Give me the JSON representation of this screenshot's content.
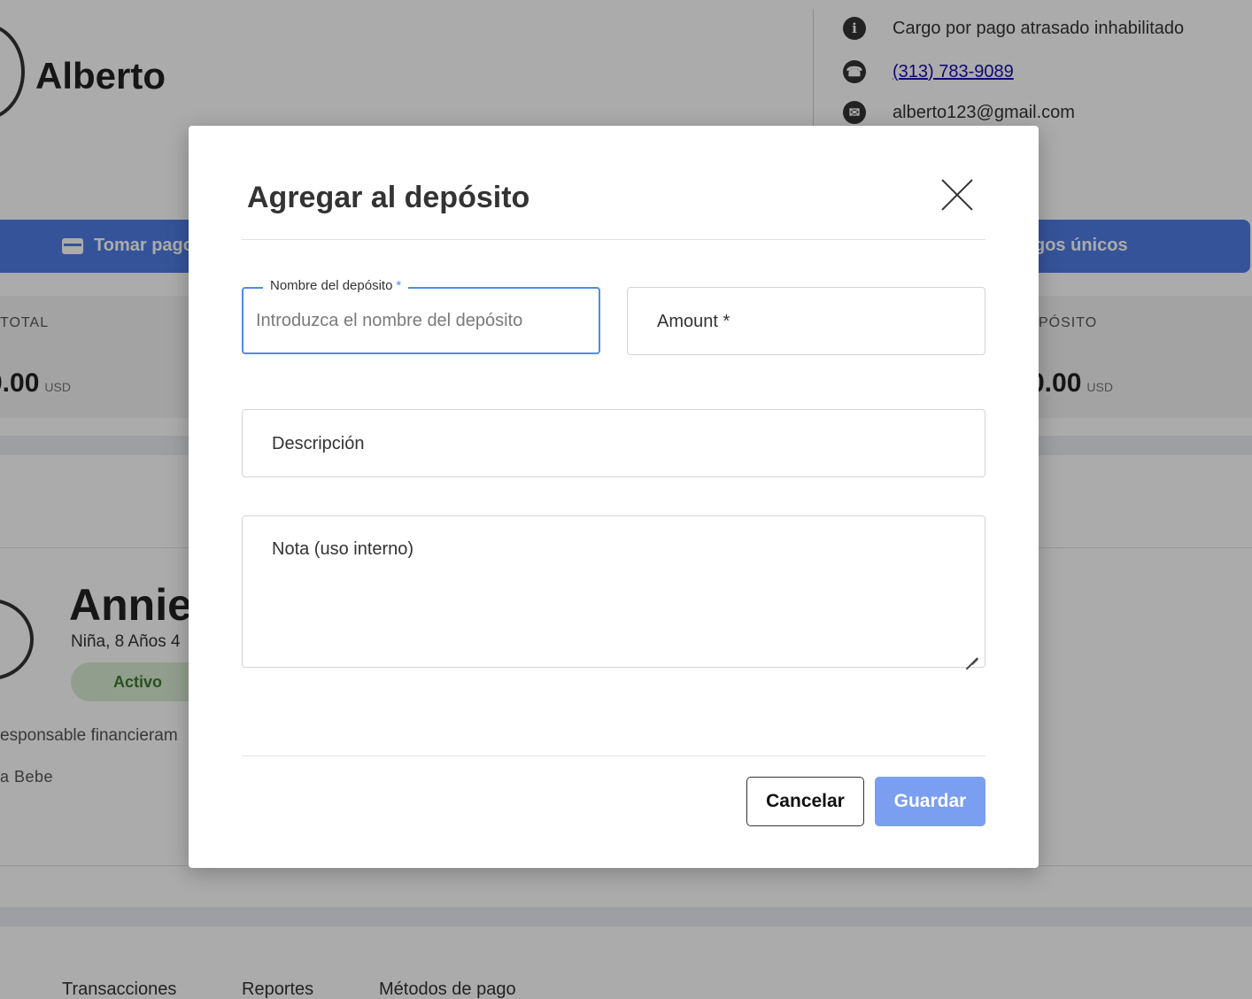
{
  "owner": {
    "name": "Alberto",
    "late_fee": "Cargo por pago atrasado inhabilitado",
    "phone": "(313) 783-9089",
    "email": "alberto123@gmail.com"
  },
  "icons": {
    "info": "i",
    "phone": "☎",
    "email": "✉"
  },
  "actions": {
    "take_payment": "Tomar pago",
    "one_time": "gos únicos"
  },
  "stats": {
    "left_label": "TOTAL",
    "left_value": "0.00",
    "left_unit": "USD",
    "right_label": "PÓSITO",
    "right_value": "0.00",
    "right_unit": "USD"
  },
  "child": {
    "name": "Annie",
    "subtitle": "Niña, 8 Años 4",
    "status": "Activo",
    "responsible": "esponsable financieram",
    "group": "a Bebe"
  },
  "tabs": [
    "Transacciones",
    "Reportes",
    "Métodos de pago"
  ],
  "modal": {
    "title": "Agregar al depósito",
    "name_label": "Nombre del depósito",
    "required_mark": "*",
    "name_placeholder": "Introduzca el nombre del depósito",
    "amount_label": "Amount *",
    "description_label": "Descripción",
    "note_placeholder": "Nota (uso interno)",
    "cancel": "Cancelar",
    "save": "Guardar"
  },
  "colors": {
    "accent": "#4f7de3",
    "focus": "#4f8be8",
    "save_button": "#7a9ef0",
    "status_bg": "#d8ecd3",
    "status_text": "#3c7a2c"
  }
}
